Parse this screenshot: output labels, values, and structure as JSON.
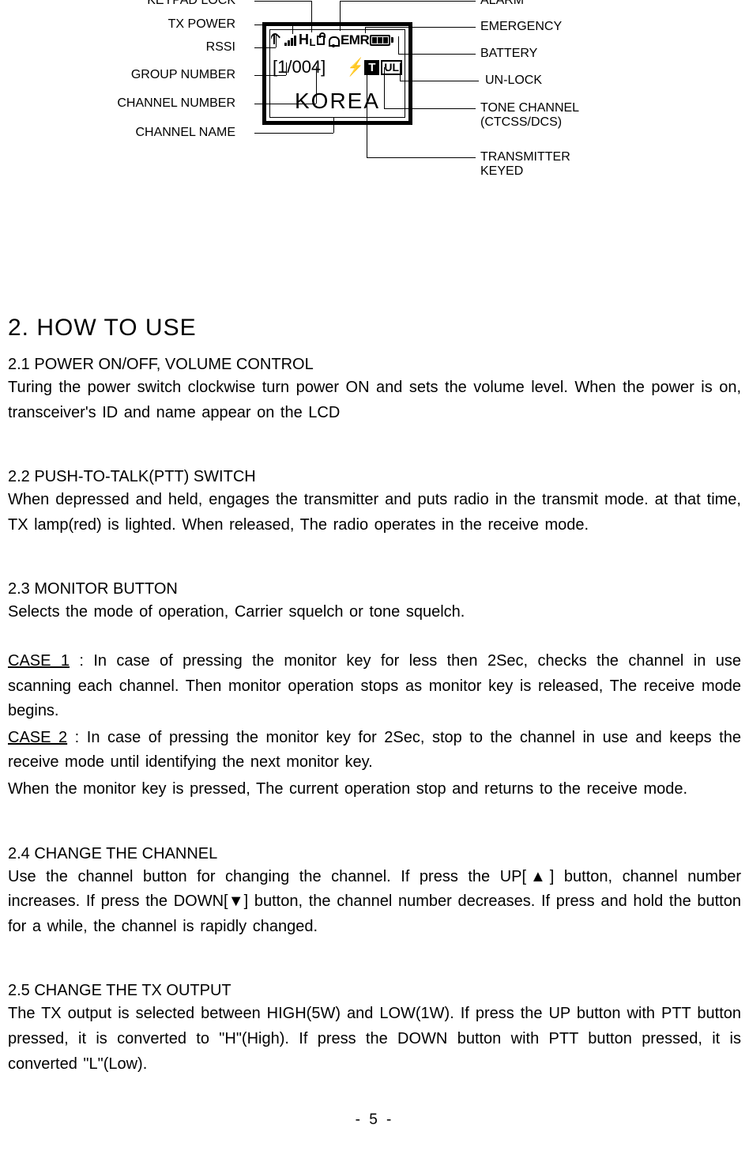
{
  "diagram": {
    "left_labels": {
      "keypad_lock": "KEYPAD LOCK",
      "tx_power": "TX POWER",
      "rssi": "RSSI",
      "group_number": "GROUP NUMBER",
      "channel_number": "CHANNEL NUMBER",
      "channel_name": "CHANNEL NAME"
    },
    "right_labels": {
      "alarm": "ALARM",
      "emergency": "EMERGENCY",
      "battery": "BATTERY",
      "unlock": "UN-LOCK",
      "tone_channel_l1": "TONE CHANNEL",
      "tone_channel_l2": "(CTCSS/DCS)",
      "tx_keyed_l1": "TRANSMITTER",
      "tx_keyed_l2": "KEYED"
    },
    "lcd": {
      "hl": "H",
      "l": "L",
      "emr": "EMR",
      "group_ch": "[1/004]",
      "t": "T",
      "ul": "UL",
      "name": "KOREA"
    }
  },
  "sections": {
    "h1": "2. HOW TO USE",
    "s21_h": "2.1 POWER ON/OFF, VOLUME CONTROL",
    "s21_p": "Turing the power switch clockwise turn power ON and sets the volume level. When the power is on, transceiver's ID and name appear on the LCD",
    "s22_h": "2.2 PUSH-TO-TALK(PTT) SWITCH",
    "s22_p": "When depressed and held, engages the transmitter and puts radio in the transmit mode. at that time, TX lamp(red) is lighted.  When released, The radio operates in the receive mode.",
    "s23_h": "2.3 MONITOR BUTTON",
    "s23_p1": "Selects the mode of operation, Carrier squelch or tone squelch.",
    "case1_label": "CASE 1",
    "s23_p2": " : In case of pressing the monitor key for less then 2Sec, checks the channel in use scanning each channel. Then monitor operation stops as monitor key is released, The receive mode begins.",
    "case2_label": "CASE 2",
    "s23_p3": " : In case of pressing the monitor key for 2Sec,  stop to the channel in use and keeps the receive mode until identifying the next monitor key.",
    "s23_p4": "When the monitor key is pressed, The current operation stop and returns to the receive mode.",
    "s24_h": "2.4 CHANGE THE CHANNEL",
    "s24_p": "Use the channel button for changing the channel. If press the UP[▲] button, channel number increases. If press the DOWN[▼] button, the channel number decreases. If press and hold the button for a while, the channel is rapidly changed.",
    "s25_h": "2.5 CHANGE THE TX OUTPUT",
    "s25_p": "The TX output is selected between HIGH(5W) and LOW(1W). If press the UP button with PTT button pressed, it is converted to \"H\"(High). If press the DOWN button with PTT button pressed, it is converted \"L\"(Low)."
  },
  "footer": "- 5 -"
}
